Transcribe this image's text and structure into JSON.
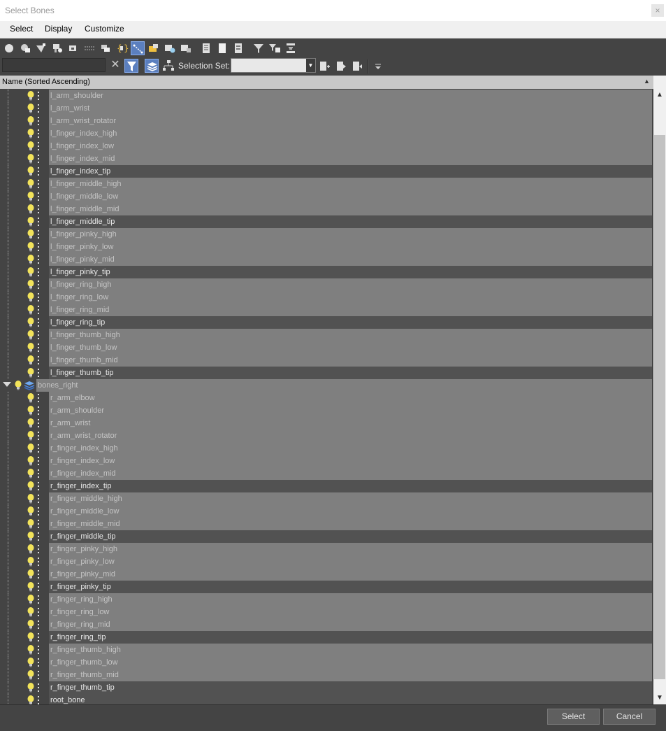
{
  "window": {
    "title": "Select Bones",
    "close_glyph": "×"
  },
  "menubar": {
    "items": [
      "Select",
      "Display",
      "Customize"
    ]
  },
  "toolbar": {
    "clear_glyph": "✕",
    "selection_set_label": "Selection Set:",
    "selection_set_value": "",
    "icons": [
      "display-geometry-icon",
      "display-shapes-icon",
      "display-lights-icon",
      "display-cameras-icon",
      "display-helpers-icon",
      "display-spacewarps-icon",
      "display-groups-icon",
      "display-xrefs-icon",
      "display-bones-icon",
      "display-containers-icon",
      "display-frozen-icon",
      "display-hidden-icon",
      "display-all-icon",
      "display-none-icon",
      "invert-display-icon",
      "select-all-icon",
      "select-none-icon",
      "select-invert-icon",
      "filter-icon",
      "filter-options-icon",
      "collapse-icon"
    ]
  },
  "list": {
    "header": "Name (Sorted Ascending)",
    "rows": [
      {
        "name": "l_arm_shoulder",
        "selected": false
      },
      {
        "name": "l_arm_wrist",
        "selected": false
      },
      {
        "name": "l_arm_wrist_rotator",
        "selected": false
      },
      {
        "name": "l_finger_index_high",
        "selected": false
      },
      {
        "name": "l_finger_index_low",
        "selected": false
      },
      {
        "name": "l_finger_index_mid",
        "selected": false
      },
      {
        "name": "l_finger_index_tip",
        "selected": true
      },
      {
        "name": "l_finger_middle_high",
        "selected": false
      },
      {
        "name": "l_finger_middle_low",
        "selected": false
      },
      {
        "name": "l_finger_middle_mid",
        "selected": false
      },
      {
        "name": "l_finger_middle_tip",
        "selected": true
      },
      {
        "name": "l_finger_pinky_high",
        "selected": false
      },
      {
        "name": "l_finger_pinky_low",
        "selected": false
      },
      {
        "name": "l_finger_pinky_mid",
        "selected": false
      },
      {
        "name": "l_finger_pinky_tip",
        "selected": true
      },
      {
        "name": "l_finger_ring_high",
        "selected": false
      },
      {
        "name": "l_finger_ring_low",
        "selected": false
      },
      {
        "name": "l_finger_ring_mid",
        "selected": false
      },
      {
        "name": "l_finger_ring_tip",
        "selected": true
      },
      {
        "name": "l_finger_thumb_high",
        "selected": false
      },
      {
        "name": "l_finger_thumb_low",
        "selected": false
      },
      {
        "name": "l_finger_thumb_mid",
        "selected": false
      },
      {
        "name": "l_finger_thumb_tip",
        "selected": true
      },
      {
        "name": "bones_right",
        "selected": false,
        "layer": true
      },
      {
        "name": "r_arm_elbow",
        "selected": false
      },
      {
        "name": "r_arm_shoulder",
        "selected": false
      },
      {
        "name": "r_arm_wrist",
        "selected": false
      },
      {
        "name": "r_arm_wrist_rotator",
        "selected": false
      },
      {
        "name": "r_finger_index_high",
        "selected": false
      },
      {
        "name": "r_finger_index_low",
        "selected": false
      },
      {
        "name": "r_finger_index_mid",
        "selected": false
      },
      {
        "name": "r_finger_index_tip",
        "selected": true
      },
      {
        "name": "r_finger_middle_high",
        "selected": false
      },
      {
        "name": "r_finger_middle_low",
        "selected": false
      },
      {
        "name": "r_finger_middle_mid",
        "selected": false
      },
      {
        "name": "r_finger_middle_tip",
        "selected": true
      },
      {
        "name": "r_finger_pinky_high",
        "selected": false
      },
      {
        "name": "r_finger_pinky_low",
        "selected": false
      },
      {
        "name": "r_finger_pinky_mid",
        "selected": false
      },
      {
        "name": "r_finger_pinky_tip",
        "selected": true
      },
      {
        "name": "r_finger_ring_high",
        "selected": false
      },
      {
        "name": "r_finger_ring_low",
        "selected": false
      },
      {
        "name": "r_finger_ring_mid",
        "selected": false
      },
      {
        "name": "r_finger_ring_tip",
        "selected": true
      },
      {
        "name": "r_finger_thumb_high",
        "selected": false
      },
      {
        "name": "r_finger_thumb_low",
        "selected": false
      },
      {
        "name": "r_finger_thumb_mid",
        "selected": false
      },
      {
        "name": "r_finger_thumb_tip",
        "selected": true
      },
      {
        "name": "root_bone",
        "selected": true
      }
    ]
  },
  "buttons": {
    "select": "Select",
    "cancel": "Cancel"
  },
  "colors": {
    "panel": "#444444",
    "row_highlight": "#7f7f7f",
    "row_selected": "#525252",
    "accent": "#5b7fbf",
    "bulb": "#f2e35a"
  }
}
